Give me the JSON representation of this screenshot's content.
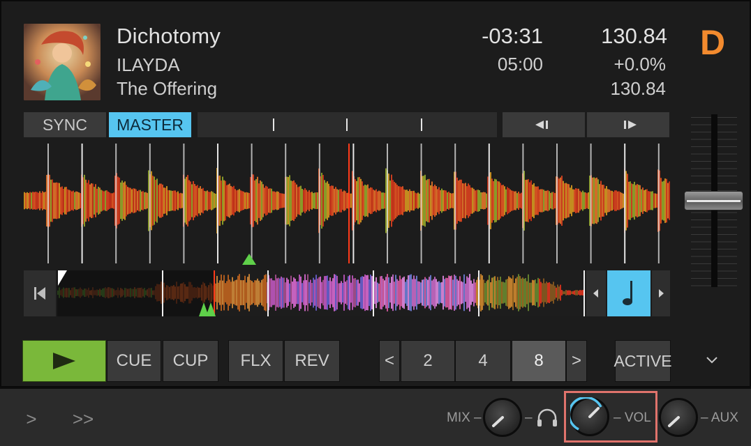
{
  "track": {
    "title": "Dichotomy",
    "artist": "ILAYDA",
    "album": "The Offering",
    "remaining": "-03:31",
    "length": "05:00",
    "bpm": "130.84",
    "pitch": "+0.0%",
    "original_bpm": "130.84"
  },
  "deck": {
    "letter": "D",
    "letter_color": "#f28a2e"
  },
  "sync_row": {
    "sync_label": "SYNC",
    "master_label": "MASTER",
    "master_active": true
  },
  "transport": {
    "play_icon": "play-icon",
    "cue_label": "CUE",
    "cup_label": "CUP",
    "flux_label": "FLX",
    "reverse_label": "REV",
    "loop_prev": "<",
    "loop_sizes": [
      "2",
      "4",
      "8"
    ],
    "loop_selected": "8",
    "loop_next": ">",
    "active_label": "ACTIVE"
  },
  "mixer": {
    "mix_label": "MIX",
    "vol_label": "VOL",
    "aux_label": "AUX",
    "headphone_icon": "headphones-icon"
  },
  "bottom_nav": {
    "prev": ">",
    "next": ">>"
  },
  "colors": {
    "accent_blue": "#56c5f0",
    "play_green": "#7ab83a",
    "deck_orange": "#f28a2e",
    "highlight_frame": "#e0736c"
  }
}
